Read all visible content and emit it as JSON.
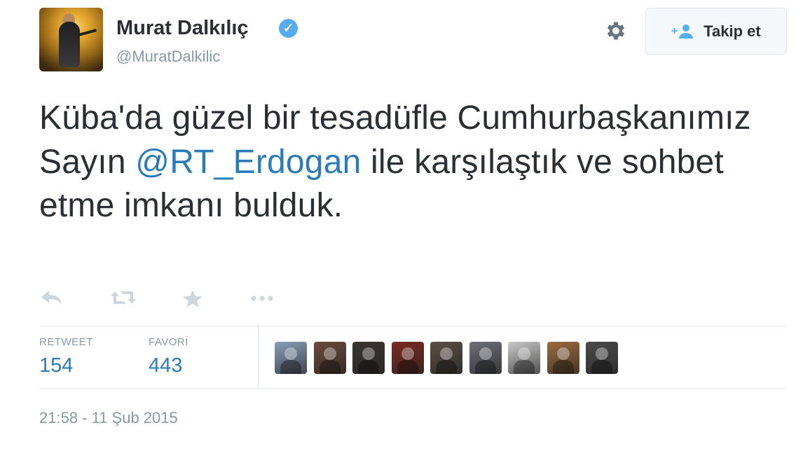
{
  "user": {
    "name": "Murat Dalkılıç",
    "handle": "@MuratDalkilic",
    "verified_icon": "verified-badge-icon"
  },
  "header": {
    "settings_icon": "gear-icon",
    "follow_label": "Takip et",
    "follow_icon": "add-user-icon"
  },
  "tweet": {
    "text_part1": "Küba'da güzel bir tesadüfle Cumhurbaşkanımız Sayın ",
    "mention": "@RT_Erdogan",
    "text_part2": " ile karşılaştık ve sohbet etme imkanı bulduk."
  },
  "actions": [
    "reply-icon",
    "retweet-icon",
    "favorite-star-icon",
    "more-icon"
  ],
  "stats": {
    "retweet_label": "RETWEET",
    "retweet_count": "154",
    "favorite_label": "FAVORİ",
    "favorite_count": "443"
  },
  "favoriters": [
    {
      "color": "#8a9fb8"
    },
    {
      "color": "#6b4a3a"
    },
    {
      "color": "#3b3530"
    },
    {
      "color": "#7a2a22"
    },
    {
      "color": "#5a4e44"
    },
    {
      "color": "#6d6f78"
    },
    {
      "color": "#c9c9c9"
    },
    {
      "color": "#9c6b3e"
    },
    {
      "color": "#4a4a4a"
    }
  ],
  "timestamp": "21:58 - 11 Şub 2015",
  "colors": {
    "link": "#2b7bb9",
    "muted": "#8899a6",
    "text": "#292f33",
    "verified": "#55acee"
  }
}
